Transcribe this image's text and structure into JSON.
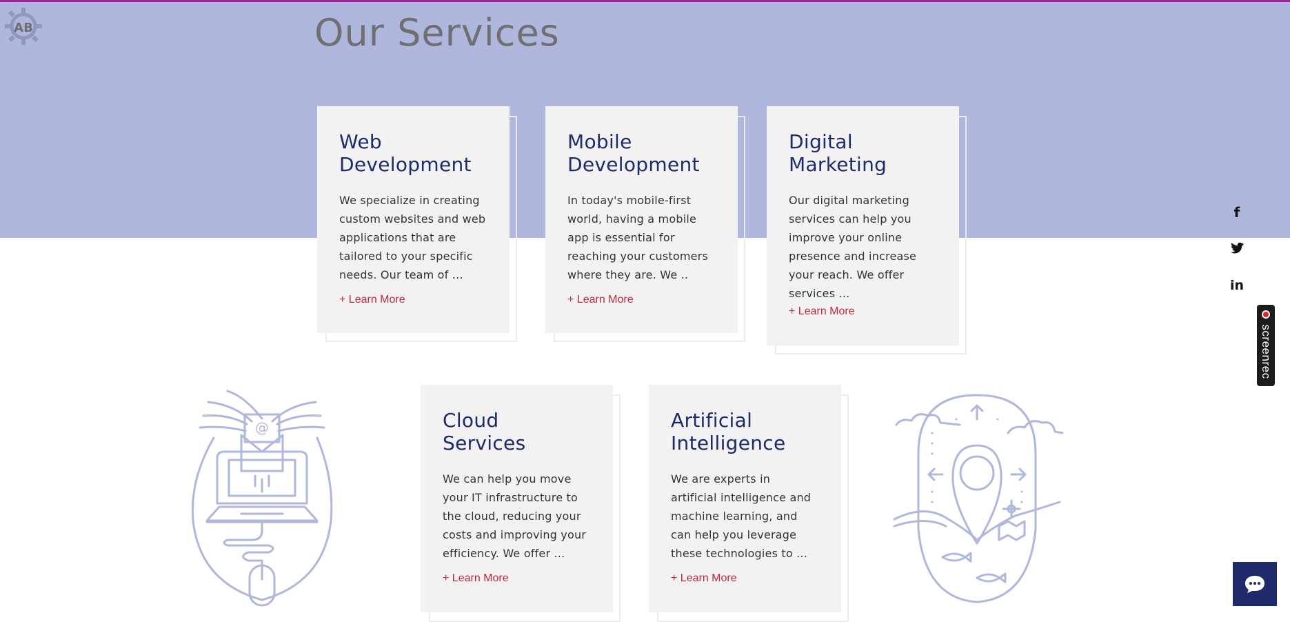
{
  "page": {
    "title": "Our Services"
  },
  "logo": {
    "text": "AB",
    "icon": "gear-logo-icon"
  },
  "colors": {
    "band": "#afb7dc",
    "accent": "#c0283f",
    "heading": "#1f2a6a",
    "top_border": "#a0229b"
  },
  "cards": [
    {
      "title_line1": "Web",
      "title_line2": "Development",
      "text": "We specialize in creating custom websites and web applications that are tailored to your specific needs. Our team of ...",
      "link": "+ Learn More"
    },
    {
      "title_line1": "Mobile",
      "title_line2": "Development",
      "text": "In today's mobile-first world, having a mobile app is essential for reaching your customers where they are. We ..",
      "link": "+ Learn More"
    },
    {
      "title_line1": "Digital",
      "title_line2": "Marketing",
      "text": "Our digital marketing services can help you improve your online presence and increase your reach. We offer services  ...",
      "link": "+ Learn More"
    },
    {
      "title_line1": "Cloud",
      "title_line2": "Services",
      "text": "We can help you move your IT infrastructure to the cloud, reducing your costs and improving your efficiency. We offer ...",
      "link": "+ Learn More"
    },
    {
      "title_line1": "Artificial",
      "title_line2": "Intelligence",
      "text": "We are experts in artificial intelligence and machine learning, and can help you leverage these technologies to ...",
      "link": "+ Learn More"
    }
  ],
  "social": {
    "facebook": "f",
    "twitter": "twitter-icon",
    "linkedin": "in"
  },
  "screenrec": {
    "label": "screenrec"
  },
  "chat": {
    "icon": "chat-bubble-icon"
  }
}
